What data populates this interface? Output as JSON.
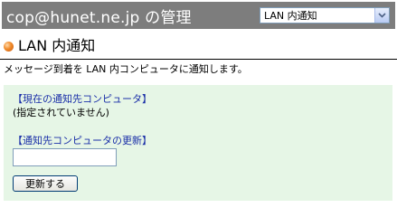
{
  "header": {
    "title": "cop@hunet.ne.jp の管理",
    "menu_select": {
      "selected": "LAN 内通知"
    }
  },
  "section": {
    "title": "LAN 内通知",
    "description": "メッセージ到着を LAN 内コンピュータに通知します。"
  },
  "current_target": {
    "label": "【現在の通知先コンピュータ】",
    "value": "(指定されていません)"
  },
  "update_target": {
    "label": "【通知先コンピュータの更新】",
    "input_value": "",
    "button_label": "更新する"
  },
  "colors": {
    "header_bg": "#7d7d7d",
    "panel_bg": "#e6f6e6",
    "label_blue": "#1a2fa8"
  }
}
